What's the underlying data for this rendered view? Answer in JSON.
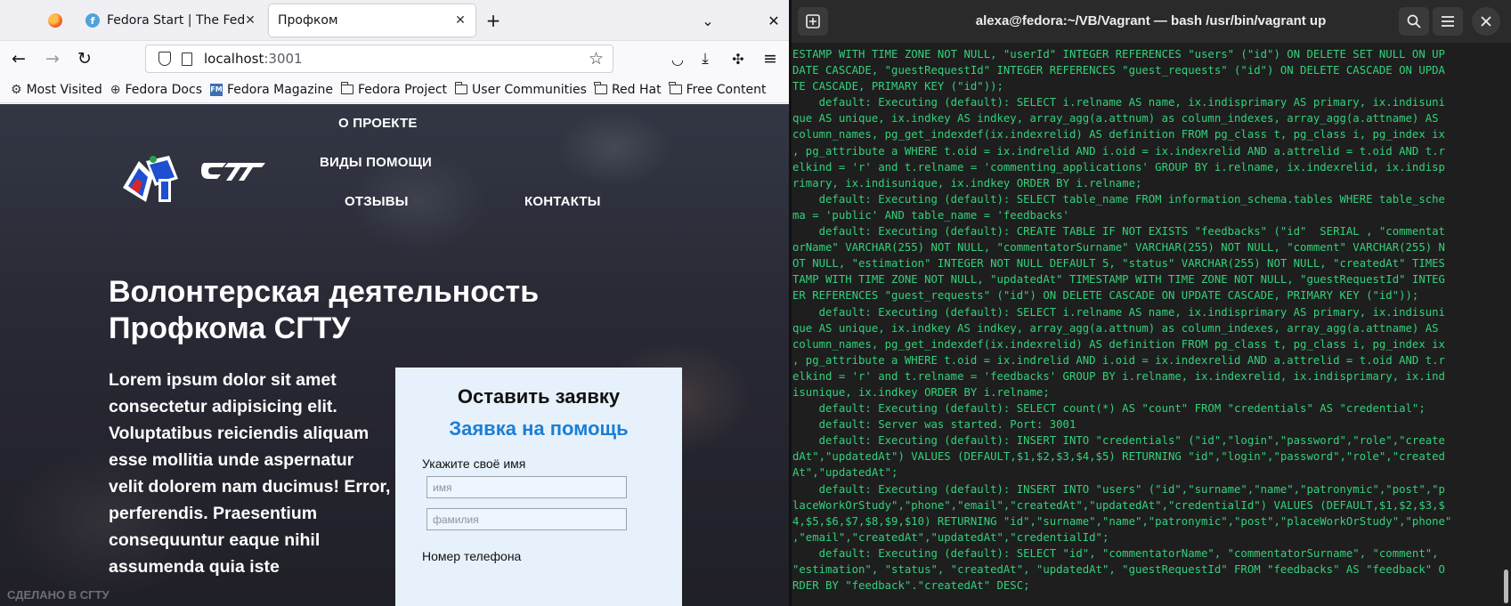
{
  "browser": {
    "tabs": [
      {
        "label": "",
        "icon": "firefox-icon"
      },
      {
        "label": "Fedora Start | The Fedora",
        "icon": "fedora-icon"
      },
      {
        "label": "Профком",
        "icon": ""
      }
    ],
    "new_tab": "+",
    "list_tabs": "⌄",
    "close_window": "✕",
    "url_host": "localhost",
    "url_port": ":3001",
    "bookmarks": [
      {
        "label": "Most Visited",
        "icon": "gear-icon"
      },
      {
        "label": "Fedora Docs",
        "icon": "globe-icon"
      },
      {
        "label": "Fedora Magazine",
        "icon": "fm-icon"
      },
      {
        "label": "Fedora Project",
        "icon": "folder-icon"
      },
      {
        "label": "User Communities",
        "icon": "folder-icon"
      },
      {
        "label": "Red Hat",
        "icon": "folder-icon"
      },
      {
        "label": "Free Content",
        "icon": "folder-icon"
      }
    ]
  },
  "site": {
    "menu": {
      "about": "О ПРОЕКТЕ",
      "help_types": "ВИДЫ ПОМОЩИ",
      "reviews": "ОТЗЫВЫ",
      "contacts": "КОНТАКТЫ"
    },
    "hero_title": "Волонтерская деятельность Профкома СГТУ",
    "hero_text": "Lorem ipsum dolor sit amet consectetur adipisicing elit. Voluptatibus reiciendis aliquam esse mollitia unde aspernatur velit dolorem nam ducimus! Error, perferendis. Praesentium consequuntur eaque nihil assumenda quia iste",
    "form": {
      "title": "Оставить заявку",
      "subtitle": "Заявка на помощь",
      "name_label": "Укажите своё имя",
      "name_placeholder": "имя",
      "surname_placeholder": "фамилия",
      "phone_label": "Номер телефона"
    },
    "watermark": "СДЕЛАНО В СГТУ"
  },
  "terminal": {
    "title": "alexa@fedora:~/VB/Vagrant — bash /usr/bin/vagrant up",
    "lines": [
      "ESTAMP WITH TIME ZONE NOT NULL, \"userId\" INTEGER REFERENCES \"users\" (\"id\") ON DELETE SET NULL ON UP",
      "DATE CASCADE, \"guestRequestId\" INTEGER REFERENCES \"guest_requests\" (\"id\") ON DELETE CASCADE ON UPDA",
      "TE CASCADE, PRIMARY KEY (\"id\"));",
      "    default: Executing (default): SELECT i.relname AS name, ix.indisprimary AS primary, ix.indisuni",
      "que AS unique, ix.indkey AS indkey, array_agg(a.attnum) as column_indexes, array_agg(a.attname) AS",
      "column_names, pg_get_indexdef(ix.indexrelid) AS definition FROM pg_class t, pg_class i, pg_index ix",
      ", pg_attribute a WHERE t.oid = ix.indrelid AND i.oid = ix.indexrelid AND a.attrelid = t.oid AND t.r",
      "elkind = 'r' and t.relname = 'commenting_applications' GROUP BY i.relname, ix.indexrelid, ix.indisp",
      "rimary, ix.indisunique, ix.indkey ORDER BY i.relname;",
      "    default: Executing (default): SELECT table_name FROM information_schema.tables WHERE table_sche",
      "ma = 'public' AND table_name = 'feedbacks'",
      "    default: Executing (default): CREATE TABLE IF NOT EXISTS \"feedbacks\" (\"id\"  SERIAL , \"commentat",
      "orName\" VARCHAR(255) NOT NULL, \"commentatorSurname\" VARCHAR(255) NOT NULL, \"comment\" VARCHAR(255) N",
      "OT NULL, \"estimation\" INTEGER NOT NULL DEFAULT 5, \"status\" VARCHAR(255) NOT NULL, \"createdAt\" TIMES",
      "TAMP WITH TIME ZONE NOT NULL, \"updatedAt\" TIMESTAMP WITH TIME ZONE NOT NULL, \"guestRequestId\" INTEG",
      "ER REFERENCES \"guest_requests\" (\"id\") ON DELETE CASCADE ON UPDATE CASCADE, PRIMARY KEY (\"id\"));",
      "    default: Executing (default): SELECT i.relname AS name, ix.indisprimary AS primary, ix.indisuni",
      "que AS unique, ix.indkey AS indkey, array_agg(a.attnum) as column_indexes, array_agg(a.attname) AS",
      "column_names, pg_get_indexdef(ix.indexrelid) AS definition FROM pg_class t, pg_class i, pg_index ix",
      ", pg_attribute a WHERE t.oid = ix.indrelid AND i.oid = ix.indexrelid AND a.attrelid = t.oid AND t.r",
      "elkind = 'r' and t.relname = 'feedbacks' GROUP BY i.relname, ix.indexrelid, ix.indisprimary, ix.ind",
      "isunique, ix.indkey ORDER BY i.relname;",
      "    default: Executing (default): SELECT count(*) AS \"count\" FROM \"credentials\" AS \"credential\";",
      "    default: Server was started. Port: 3001",
      "    default: Executing (default): INSERT INTO \"credentials\" (\"id\",\"login\",\"password\",\"role\",\"create",
      "dAt\",\"updatedAt\") VALUES (DEFAULT,$1,$2,$3,$4,$5) RETURNING \"id\",\"login\",\"password\",\"role\",\"created",
      "At\",\"updatedAt\";",
      "    default: Executing (default): INSERT INTO \"users\" (\"id\",\"surname\",\"name\",\"patronymic\",\"post\",\"p",
      "laceWorkOrStudy\",\"phone\",\"email\",\"createdAt\",\"updatedAt\",\"credentialId\") VALUES (DEFAULT,$1,$2,$3,$",
      "4,$5,$6,$7,$8,$9,$10) RETURNING \"id\",\"surname\",\"name\",\"patronymic\",\"post\",\"placeWorkOrStudy\",\"phone\"",
      ",\"email\",\"createdAt\",\"updatedAt\",\"credentialId\";",
      "    default: Executing (default): SELECT \"id\", \"commentatorName\", \"commentatorSurname\", \"comment\",",
      "\"estimation\", \"status\", \"createdAt\", \"updatedAt\", \"guestRequestId\" FROM \"feedbacks\" AS \"feedback\" O",
      "RDER BY \"feedback\".\"createdAt\" DESC;"
    ]
  },
  "colors": {
    "terminal_text": "#33d17a",
    "terminal_bg": "#1e1e1e",
    "form_bg": "#e7f1fb",
    "form_subtitle": "#1b7ed6"
  }
}
